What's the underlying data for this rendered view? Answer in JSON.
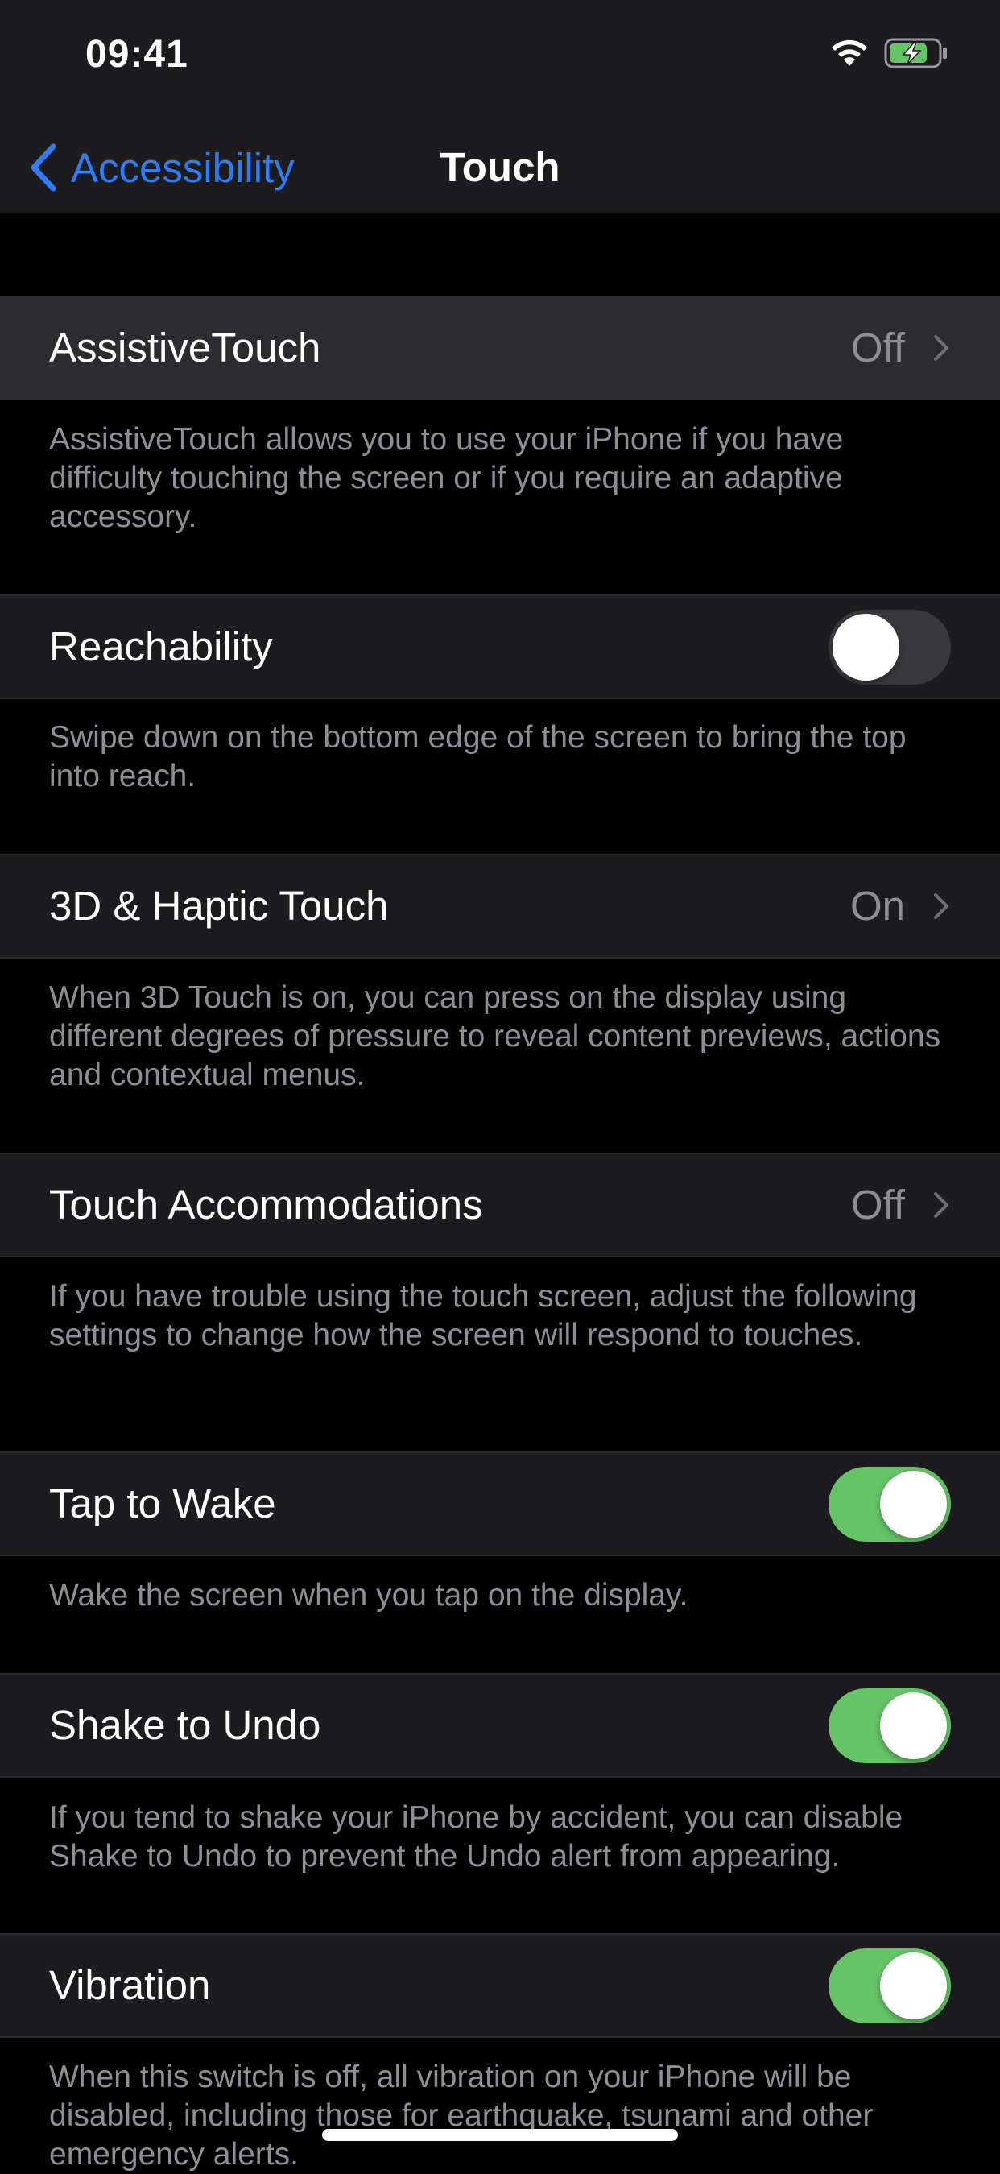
{
  "status_bar": {
    "time": "09:41",
    "icons": [
      "wifi-icon",
      "battery-charging-icon"
    ]
  },
  "nav": {
    "back_label": "Accessibility",
    "title": "Touch",
    "back_icon": "chevron-left-icon"
  },
  "colors": {
    "background": "#000000",
    "cell": "#1c1c1e",
    "accent": "#2f7df6",
    "toggle_on": "#65c466",
    "toggle_off": "#39393d",
    "secondary_text": "#8e8e93"
  },
  "settings": [
    {
      "label": "AssistiveTouch",
      "value": "Off",
      "control": "disclosure",
      "footer": "AssistiveTouch allows you to use your iPhone if you have difficulty touching the screen or if you require an adaptive accessory."
    },
    {
      "label": "Reachability",
      "control": "toggle",
      "on": false,
      "footer": "Swipe down on the bottom edge of the screen to bring the top into reach."
    },
    {
      "label": "3D & Haptic Touch",
      "value": "On",
      "control": "disclosure",
      "footer": "When 3D Touch is on, you can press on the display using different degrees of pressure to reveal content previews, actions and contextual menus."
    },
    {
      "label": "Touch Accommodations",
      "value": "Off",
      "control": "disclosure",
      "footer": "If you have trouble using the touch screen, adjust the following settings to change how the screen will respond to touches."
    },
    {
      "label": "Tap to Wake",
      "control": "toggle",
      "on": true,
      "footer": "Wake the screen when you tap on the display."
    },
    {
      "label": "Shake to Undo",
      "control": "toggle",
      "on": true,
      "footer": "If you tend to shake your iPhone by accident, you can disable Shake to Undo to prevent the Undo alert from appearing."
    },
    {
      "label": "Vibration",
      "control": "toggle",
      "on": true,
      "footer": "When this switch is off, all vibration on your iPhone will be disabled, including those for earthquake, tsunami and other emergency alerts."
    }
  ]
}
